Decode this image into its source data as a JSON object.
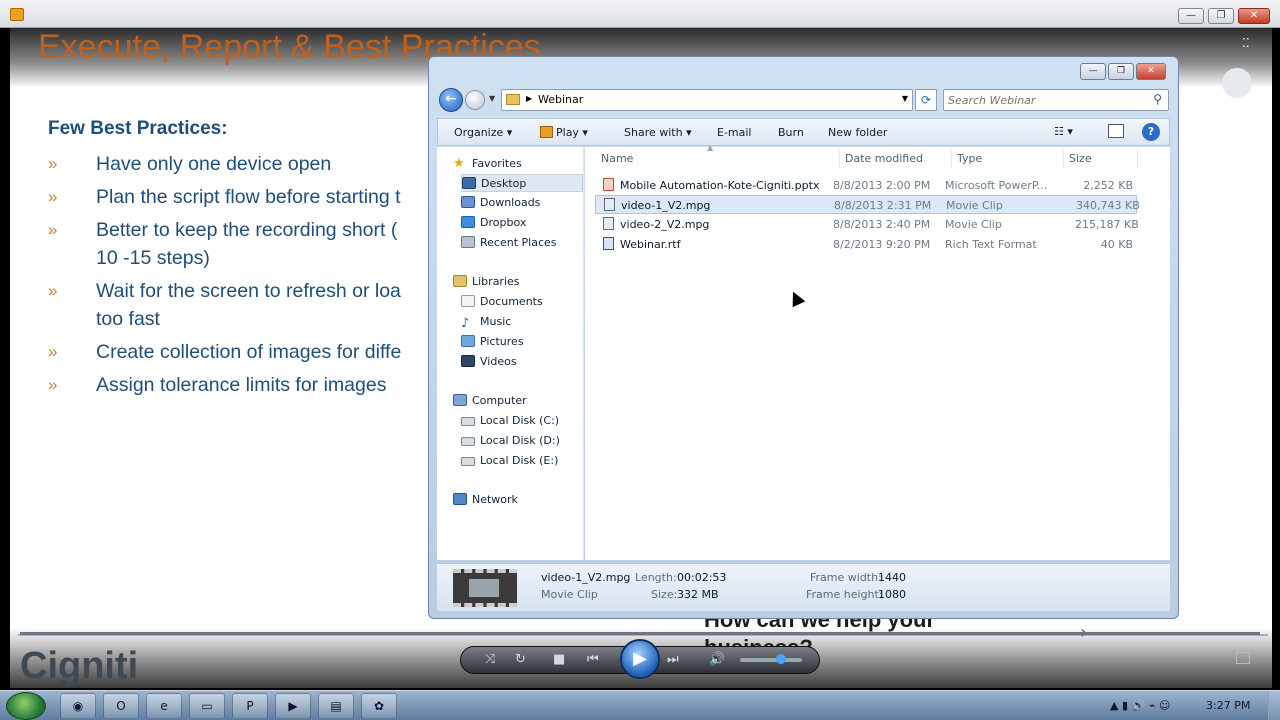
{
  "player": {
    "title": "",
    "min": "—",
    "max": "❐",
    "close": "✕"
  },
  "slide": {
    "title": "Execute, Report & Best Practices",
    "subtitle": "Few Best Practices:",
    "bullet_mark": "»",
    "bullets": [
      "Have only one device open",
      "Plan the script flow before starting t",
      "Better to keep the recording short (\n10 -15 steps)",
      "Wait for the screen to refresh or loa\ntoo fast",
      "Create collection of images for diffe",
      "Assign tolerance limits for images"
    ],
    "promo": "How can we help your\nbusiness?",
    "logo": "Cigniti"
  },
  "explorer": {
    "address": "Webinar",
    "search_placeholder": "Search Webinar",
    "toolbar": {
      "organize": "Organize ▾",
      "play": "Play ▾",
      "share": "Share with ▾",
      "email": "E-mail",
      "burn": "Burn",
      "new_folder": "New folder"
    },
    "nav": {
      "favorites": "Favorites",
      "desktop": "Desktop",
      "downloads": "Downloads",
      "dropbox": "Dropbox",
      "recent": "Recent Places",
      "libraries": "Libraries",
      "documents": "Documents",
      "music": "Music",
      "pictures": "Pictures",
      "videos": "Videos",
      "computer": "Computer",
      "disk_c": "Local Disk (C:)",
      "disk_d": "Local Disk (D:)",
      "disk_e": "Local Disk (E:)",
      "network": "Network"
    },
    "columns": {
      "name": "Name",
      "date": "Date modified",
      "type": "Type",
      "size": "Size"
    },
    "files": [
      {
        "name": "Mobile Automation-Kote-Cigniti.pptx",
        "date": "8/8/2013 2:00 PM",
        "type": "Microsoft PowerP...",
        "size": "2,252 KB"
      },
      {
        "name": "video-1_V2.mpg",
        "date": "8/8/2013 2:31 PM",
        "type": "Movie Clip",
        "size": "340,743 KB"
      },
      {
        "name": "video-2_V2.mpg",
        "date": "8/8/2013 2:40 PM",
        "type": "Movie Clip",
        "size": "215,187 KB"
      },
      {
        "name": "Webinar.rtf",
        "date": "8/2/2013 9:20 PM",
        "type": "Rich Text Format",
        "size": "40 KB"
      }
    ],
    "details": {
      "filename": "video-1_V2.mpg",
      "kind": "Movie Clip",
      "length_label": "Length:",
      "length": "00:02:53",
      "size_label": "Size:",
      "size": "332 MB",
      "width_label": "Frame width:",
      "width": "1440",
      "height_label": "Frame height:",
      "height": "1080"
    }
  },
  "taskbar": {
    "time": "3:27 PM"
  }
}
